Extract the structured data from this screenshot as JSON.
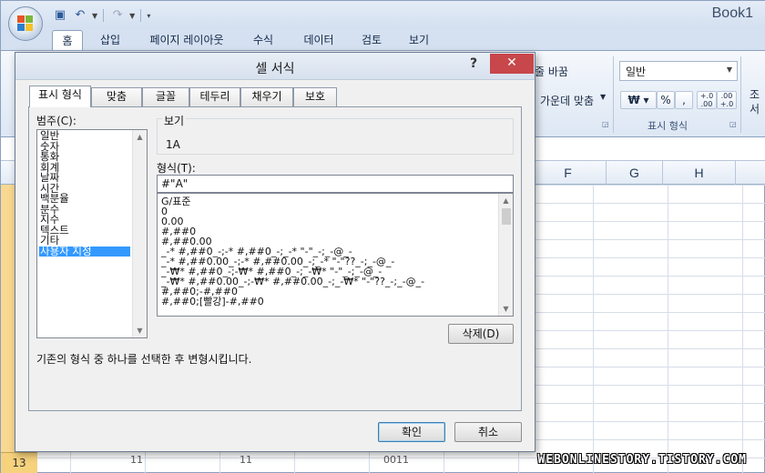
{
  "app": {
    "title": "Book1"
  },
  "ribbon": {
    "tabs": [
      "홈",
      "삽입",
      "페이지 레이아웃",
      "수식",
      "데이터",
      "검토",
      "보기"
    ],
    "alignment": {
      "wrap_text": "줄 바꿈",
      "merge_center": "가운데 맞춤"
    },
    "number": {
      "format_select": "일반",
      "currency_symbol": "₩",
      "percent_symbol": "%",
      "comma_symbol": ",",
      "increase_decimal": "+.0 .00",
      "decrease_decimal": ".00 +.0",
      "group_label": "표시 형식"
    },
    "styles_partial": "조\n서"
  },
  "sheet": {
    "columns": [
      "F",
      "G",
      "H"
    ],
    "last_row": {
      "number": "13",
      "values": [
        "11",
        "11",
        "0011"
      ]
    }
  },
  "dialog": {
    "title": "셀 서식",
    "help": "?",
    "close": "✕",
    "tabs": [
      "표시 형식",
      "맞춤",
      "글꼴",
      "테두리",
      "채우기",
      "보호"
    ],
    "category_label": "범주(C):",
    "categories": [
      "일반",
      "숫자",
      "통화",
      "회계",
      "날짜",
      "시간",
      "백분율",
      "분수",
      "지수",
      "텍스트",
      "기타",
      "사용자 지정"
    ],
    "selected_category": "사용자 지정",
    "sample_label": "보기",
    "sample_value": "1A",
    "type_label": "형식(T):",
    "type_value": "#\"A\"",
    "format_codes": [
      "G/표준",
      "0",
      "0.00",
      "#,##0",
      "#,##0.00",
      "_-* #,##0_-;-* #,##0_-;_-* \"-\"_-;_-@_-",
      "_-* #,##0.00_-;-* #,##0.00_-;_-* \"-\"??_-;_-@_-",
      "_-₩* #,##0_-;-₩* #,##0_-;_-₩* \"-\"_-;_-@_-",
      "_-₩* #,##0.00_-;-₩* #,##0.00_-;_-₩* \"-\"??_-;_-@_-",
      "#,##0;-#,##0",
      "#,##0;[빨강]-#,##0"
    ],
    "delete_button": "삭제(D)",
    "description": "기존의 형식 중 하나를 선택한 후 변형시킵니다.",
    "ok_button": "확인",
    "cancel_button": "취소"
  },
  "watermark": "WEBONLINESTORY.TISTORY.COM",
  "colors": {
    "accent": "#3399ff",
    "close": "#c7474a",
    "arrow": "#e74c3c",
    "row_highlight": "#f9d990"
  }
}
